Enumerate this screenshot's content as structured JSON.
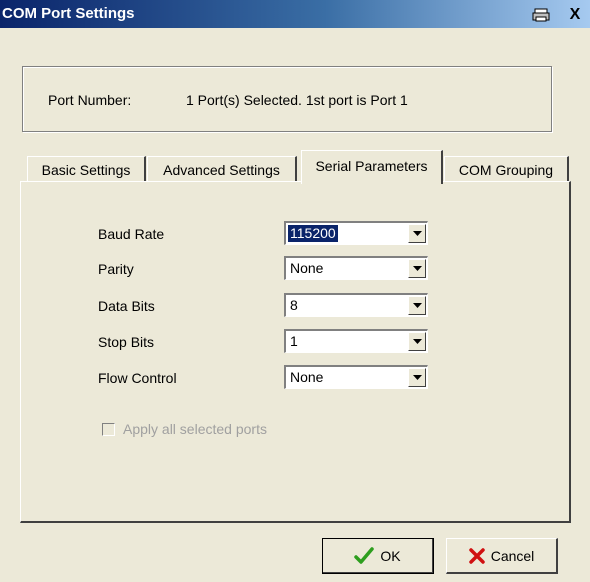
{
  "window": {
    "title": "COM Port Settings",
    "print_icon": "printer-icon",
    "close_label": "X"
  },
  "port": {
    "label": "Port Number:",
    "value": "1 Port(s) Selected. 1st port is Port 1"
  },
  "tabs": [
    {
      "label": "Basic Settings",
      "active": false
    },
    {
      "label": "Advanced Settings",
      "active": false
    },
    {
      "label": "Serial Parameters",
      "active": true
    },
    {
      "label": "COM Grouping",
      "active": false
    }
  ],
  "fields": {
    "baud_rate": {
      "label": "Baud Rate",
      "value": "115200"
    },
    "parity": {
      "label": "Parity",
      "value": "None"
    },
    "data_bits": {
      "label": "Data Bits",
      "value": "8"
    },
    "stop_bits": {
      "label": "Stop Bits",
      "value": "1"
    },
    "flow_control": {
      "label": "Flow Control",
      "value": "None"
    }
  },
  "apply_all": {
    "label": "Apply all selected ports",
    "checked": false,
    "enabled": false
  },
  "buttons": {
    "ok": {
      "label": "OK",
      "icon": "checkmark-icon"
    },
    "cancel": {
      "label": "Cancel",
      "icon": "x-icon"
    }
  },
  "colors": {
    "titlebar": "#0a246a",
    "selection": "#0a246a",
    "ok_icon": "#2e9e1e",
    "cancel_icon": "#d01010"
  }
}
